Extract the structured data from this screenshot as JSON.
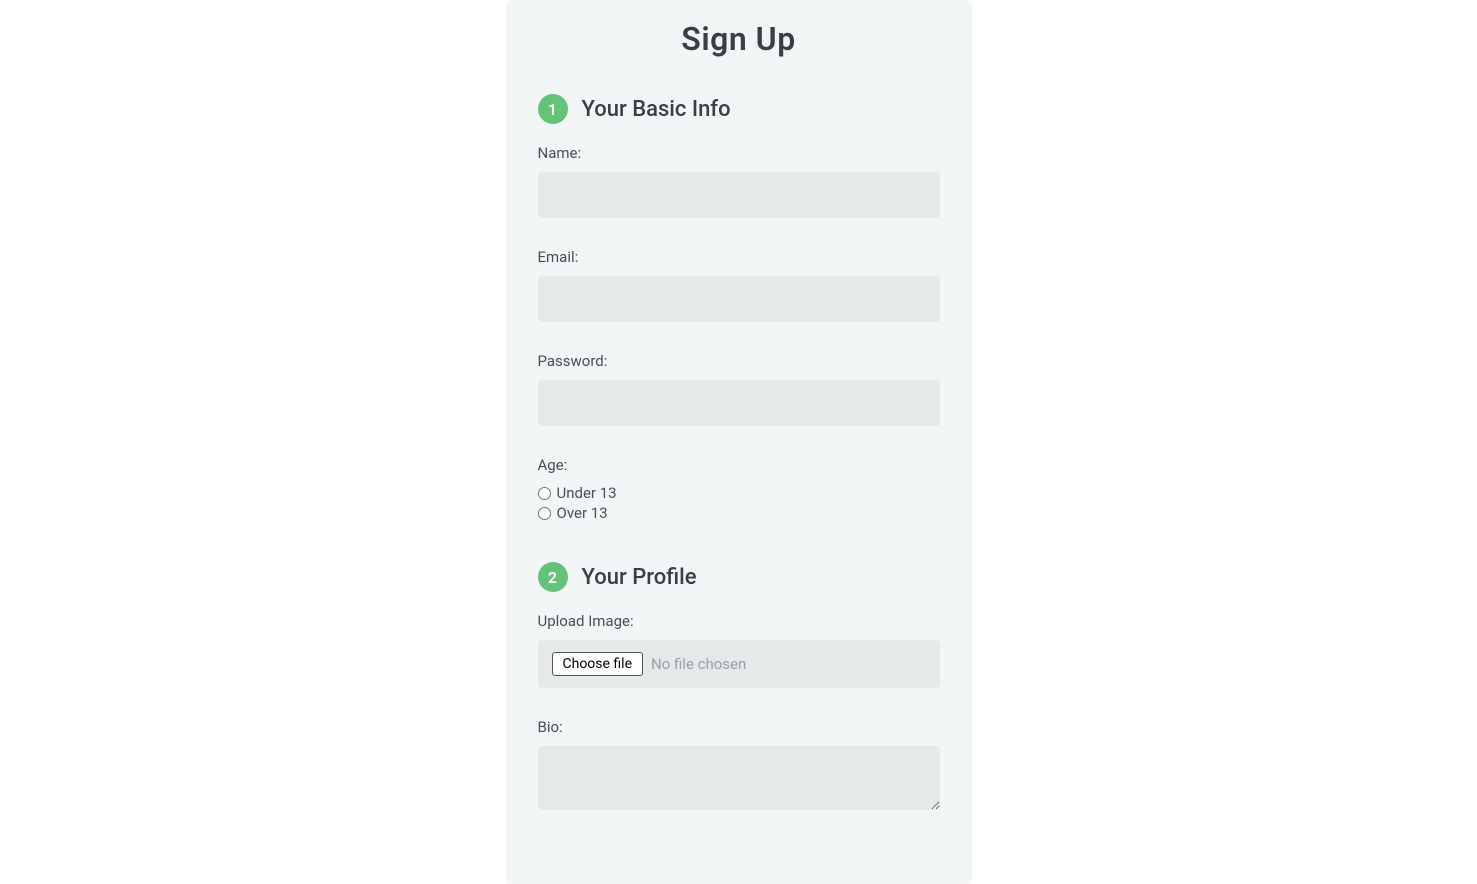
{
  "page": {
    "title": "Sign Up"
  },
  "sections": {
    "basic": {
      "number": "1",
      "title": "Your Basic Info",
      "fields": {
        "name_label": "Name:",
        "name_value": "",
        "email_label": "Email:",
        "email_value": "",
        "password_label": "Password:",
        "password_value": "",
        "age_label": "Age:",
        "age_under_label": "Under 13",
        "age_over_label": "Over 13"
      }
    },
    "profile": {
      "number": "2",
      "title": "Your Profile",
      "fields": {
        "upload_label": "Upload Image:",
        "choose_file_button": "Choose file",
        "file_status": "No file chosen",
        "bio_label": "Bio:",
        "bio_value": ""
      }
    }
  }
}
